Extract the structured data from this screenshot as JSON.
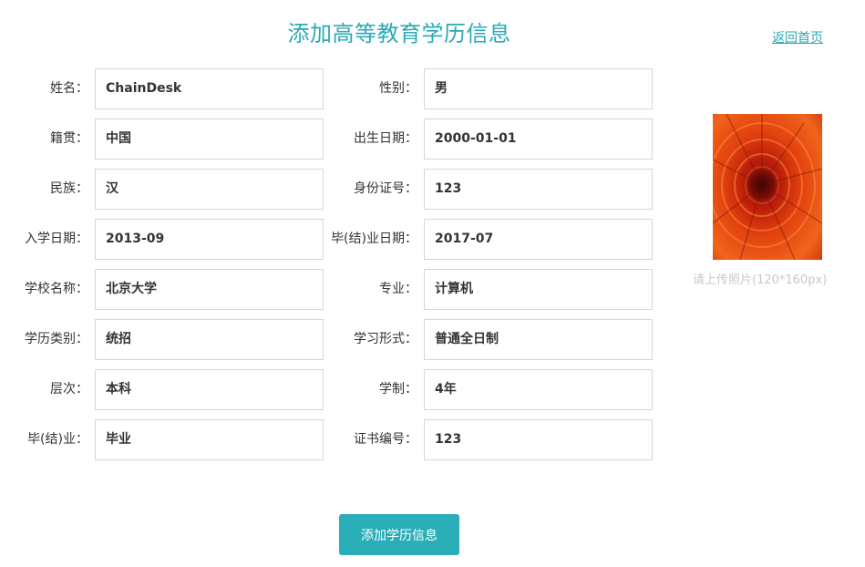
{
  "header": {
    "title": "添加高等教育学历信息",
    "home_link": "返回首页"
  },
  "form": {
    "left": [
      {
        "label": "姓名：",
        "value": "ChainDesk"
      },
      {
        "label": "籍贯：",
        "value": "中国"
      },
      {
        "label": "民族：",
        "value": "汉"
      },
      {
        "label": "入学日期：",
        "value": "2013-09"
      },
      {
        "label": "学校名称：",
        "value": "北京大学"
      },
      {
        "label": "学历类别：",
        "value": "统招"
      },
      {
        "label": "层次：",
        "value": "本科"
      },
      {
        "label": "毕(结)业：",
        "value": "毕业"
      }
    ],
    "right": [
      {
        "label": "性别：",
        "value": "男"
      },
      {
        "label": "出生日期：",
        "value": "2000-01-01"
      },
      {
        "label": "身份证号：",
        "value": "123"
      },
      {
        "label": "毕(结)业日期：",
        "value": "2017-07"
      },
      {
        "label": "专业：",
        "value": "计算机"
      },
      {
        "label": "学习形式：",
        "value": "普通全日制"
      },
      {
        "label": "学制：",
        "value": "4年"
      },
      {
        "label": "证书编号：",
        "value": "123"
      }
    ]
  },
  "photo": {
    "hint": "请上传照片(120*160px)"
  },
  "submit_label": "添加学历信息",
  "colors": {
    "accent": "#2aaeb7",
    "border": "#d6d6d6",
    "hint": "#c8c8c8"
  }
}
